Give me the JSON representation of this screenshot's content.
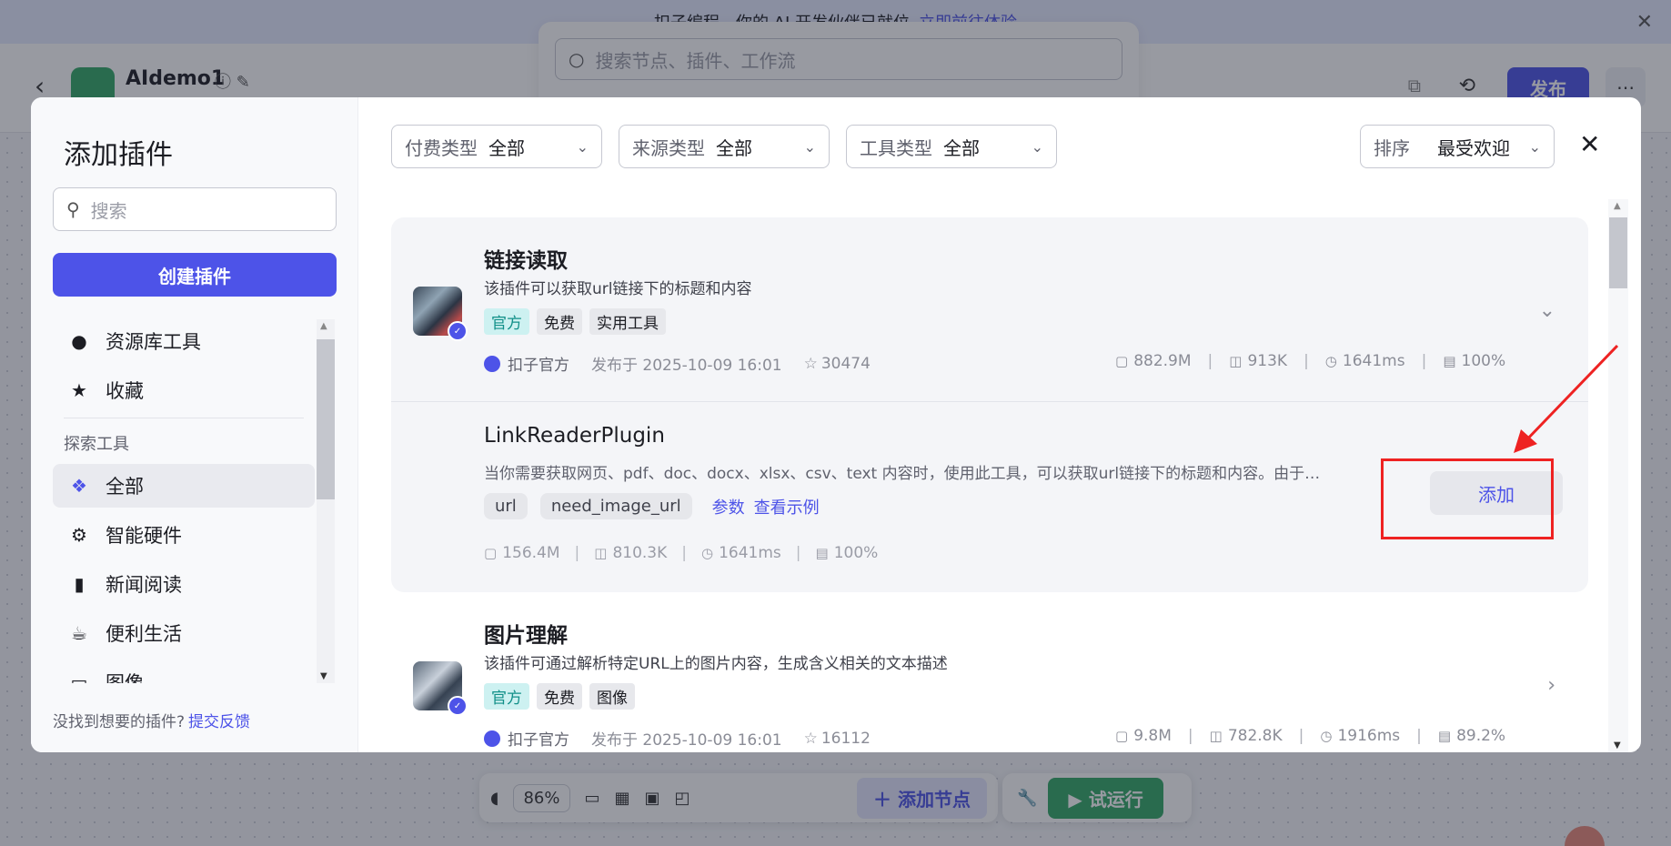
{
  "background": {
    "banner_text": "扣子编程，你的 AI 开发伙伴已就位",
    "banner_link": "立即前往体验",
    "app_name": "AIdemo1",
    "publish_label": "发布",
    "canvas_search_placeholder": "搜索节点、插件、工作流",
    "zoom_value": "86%",
    "add_node_label": "添加节点",
    "run_label": "试运行"
  },
  "modal": {
    "title": "添加插件",
    "search_placeholder": "搜索",
    "create_button": "创建插件",
    "nav": {
      "items": [
        {
          "label": "资源库工具",
          "icon": "person-icon"
        },
        {
          "label": "收藏",
          "icon": "star-icon"
        }
      ],
      "section_title": "探索工具",
      "explore": [
        {
          "label": "全部",
          "icon": "grid-icon"
        },
        {
          "label": "智能硬件",
          "icon": "chip-icon"
        },
        {
          "label": "新闻阅读",
          "icon": "book-icon"
        },
        {
          "label": "便利生活",
          "icon": "cup-icon"
        },
        {
          "label": "图像",
          "icon": "image-icon"
        }
      ]
    },
    "feedback_text": "没找到想要的插件?",
    "feedback_link": "提交反馈",
    "filters": [
      {
        "label": "付费类型",
        "value": "全部"
      },
      {
        "label": "来源类型",
        "value": "全部"
      },
      {
        "label": "工具类型",
        "value": "全部"
      }
    ],
    "sort": {
      "label": "排序",
      "value": "最受欢迎"
    }
  },
  "plugins": [
    {
      "name": "链接读取",
      "description": "该插件可以获取url链接下的标题和内容",
      "tags": [
        "官方",
        "免费",
        "实用工具"
      ],
      "author": "扣子官方",
      "published": "发布于 2025-10-09 16:01",
      "stars": "30474",
      "stats": [
        "882.9M",
        "913K",
        "1641ms",
        "100%"
      ],
      "tool": {
        "name": "LinkReaderPlugin",
        "description": "当你需要获取网页、pdf、doc、docx、xlsx、csv、text 内容时，使用此工具，可以获取url链接下的标题和内容。由于…",
        "params": [
          "url",
          "need_image_url"
        ],
        "links": [
          "参数",
          "查看示例"
        ],
        "stats": [
          "156.4M",
          "810.3K",
          "1641ms",
          "100%"
        ],
        "add_label": "添加"
      }
    },
    {
      "name": "图片理解",
      "description": "该插件可通过解析特定URL上的图片内容，生成含义相关的文本描述",
      "tags": [
        "官方",
        "免费",
        "图像"
      ],
      "author": "扣子官方",
      "published": "发布于 2025-10-09 16:01",
      "stars": "16112",
      "stats": [
        "9.8M",
        "782.8K",
        "1916ms",
        "89.2%"
      ]
    }
  ],
  "colors": {
    "accent": "#4d53e8",
    "highlight": "#ee2222",
    "official_tag": "#129089"
  }
}
